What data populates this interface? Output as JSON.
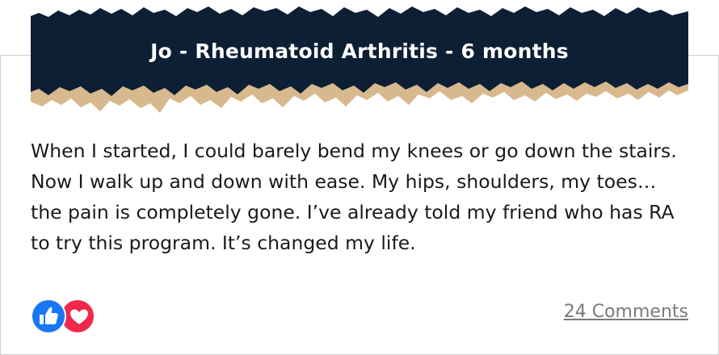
{
  "banner": {
    "title": "Jo - Rheumatoid Arthritis - 6 months",
    "colors": {
      "background": "#0c1f34",
      "torn_paper": "#d8b98e"
    }
  },
  "testimonial": {
    "text": "When I started, I could barely bend my knees or go down the stairs. Now I walk up and down with ease. My hips, shoulders, my toes… the pain is completely gone. I’ve already told my friend who has RA to try this program. It’s changed my life."
  },
  "reactions": {
    "icons": [
      "like-icon",
      "love-icon"
    ],
    "colors": {
      "like": "#1877f2",
      "love": "#f02849"
    }
  },
  "comments": {
    "label": "24 Comments"
  }
}
